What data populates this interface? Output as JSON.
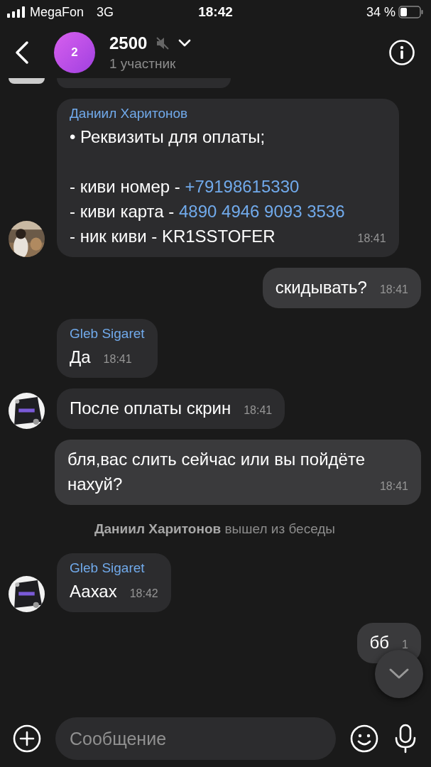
{
  "status_bar": {
    "carrier": "MegaFon",
    "network": "3G",
    "time": "18:42",
    "battery": "34 %"
  },
  "header": {
    "avatar_label": "2",
    "title": "2500",
    "muted": true,
    "subtitle": "1 участник"
  },
  "messages": [
    {
      "kind": "cut"
    },
    {
      "kind": "incoming",
      "sender": "Даниил Харитонов",
      "avatar": true,
      "time": "18:41",
      "body": [
        {
          "kind": "text",
          "text": "• Реквизиты для оплаты;\n\n- киви номер - "
        },
        {
          "kind": "link",
          "text": "+79198615330"
        },
        {
          "kind": "text",
          "text": "\n- киви карта - "
        },
        {
          "kind": "link",
          "text": "4890 4946 9093 3536"
        },
        {
          "kind": "text",
          "text": "\n- ник киви - KR1SSTOFER"
        }
      ]
    },
    {
      "kind": "outgoing",
      "time": "18:41",
      "body": [
        {
          "kind": "text",
          "text": "скидывать?"
        }
      ]
    },
    {
      "kind": "incoming",
      "sender": "Gleb Sigaret",
      "avatar": false,
      "time": "18:41",
      "body": [
        {
          "kind": "text",
          "text": "Да"
        }
      ]
    },
    {
      "kind": "incoming",
      "avatar": true,
      "time": "18:41",
      "body": [
        {
          "kind": "text",
          "text": "После оплаты скрин"
        }
      ]
    },
    {
      "kind": "outgoing",
      "time": "18:41",
      "body": [
        {
          "kind": "text",
          "text": "бля,вас слить сейчас или вы пойдёте нахуй?"
        }
      ]
    },
    {
      "kind": "system",
      "text": "**Даниил Харитонов** вышел из беседы"
    },
    {
      "kind": "incoming",
      "sender": "Gleb Sigaret",
      "avatar": true,
      "time": "18:42",
      "body": [
        {
          "kind": "text",
          "text": "Аахах"
        }
      ]
    },
    {
      "kind": "outgoing",
      "time": "1",
      "body": [
        {
          "kind": "text",
          "text": "бб"
        }
      ]
    }
  ],
  "composer": {
    "placeholder": "Сообщение"
  }
}
